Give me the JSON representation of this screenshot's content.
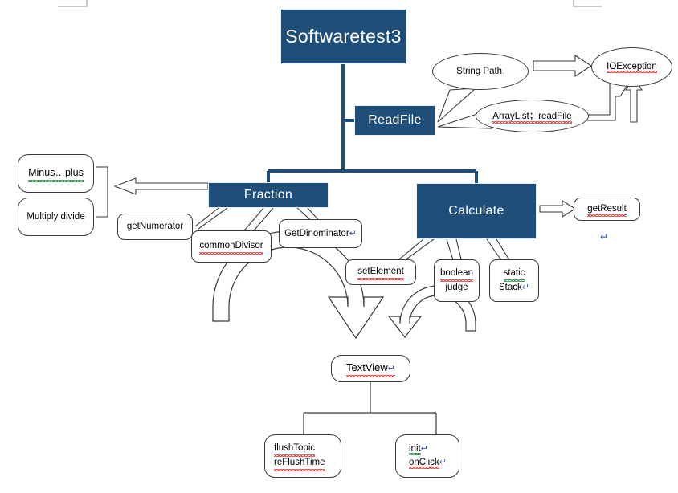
{
  "diagram": {
    "title": "Softwaretest3",
    "colors": {
      "box_fill": "#1F4E79",
      "box_text": "#FFFFFF",
      "connector": "#1F4E79",
      "outline": "#3A3A3A",
      "spellcheck_red": "#E03030",
      "spellcheck_green": "#1A8A3A",
      "pilcrow": "#3355AA",
      "background": "#FFFFFF"
    },
    "nodes": {
      "root": {
        "label": "Softwaretest3"
      },
      "readfile": {
        "label": "ReadFile"
      },
      "fraction": {
        "label": "Fraction"
      },
      "calculate": {
        "label": "Calculate"
      }
    },
    "ovals": {
      "string_path": {
        "label": "String  Path"
      },
      "arraylist_readfile": {
        "label": "ArrayList；readFile"
      },
      "ioexception": {
        "label": "IOException"
      }
    },
    "callouts": {
      "minus_plus": {
        "label": "Minus…plus"
      },
      "multiply_divide": {
        "label": "Multiply divide"
      },
      "get_numerator": {
        "label": "getNumerator"
      },
      "common_divisor": {
        "label": "commonDivisor"
      },
      "get_dinominator": {
        "label": "GetDinominator",
        "mark": "↵"
      },
      "set_element": {
        "label": "setElement"
      },
      "boolean_judge": {
        "line1": "boolean",
        "line2": "judge"
      },
      "static_stack": {
        "line1": "static",
        "line2": "Stack",
        "mark": "↵"
      },
      "get_result": {
        "label": "getResult"
      },
      "textview": {
        "label": "TextView",
        "mark": "↵"
      },
      "flush": {
        "line1": "flushTopic",
        "line2": "reFlushTime"
      },
      "init_onclick": {
        "line1": "init",
        "line2": "onClick",
        "mark": "↵"
      }
    },
    "marks": {
      "pilcrow": "↵",
      "stray_pilcrow": "↵",
      "dot": "."
    }
  }
}
